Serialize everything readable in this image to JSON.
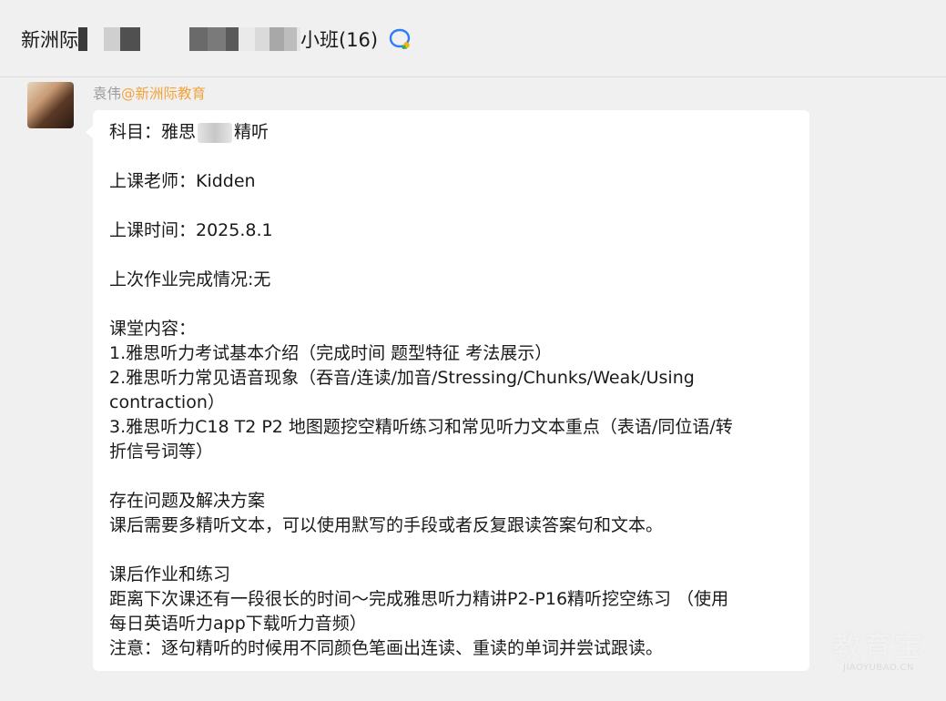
{
  "header": {
    "title_start": "新洲际",
    "title_end": "小班(16)",
    "mosaic_colors": [
      "#3a3a3a",
      "#f0f0f0",
      "#cfcfcf",
      "#505050",
      "#f0f0f0",
      "#f0f0f0",
      "#6a6a6a",
      "#7a7a7a",
      "#5a5a5a",
      "#eaeaea",
      "#dadada",
      "#a8a8a8",
      "#bdbdbd",
      "#e6e6e6"
    ]
  },
  "message": {
    "sender_name": "袁伟",
    "sender_org": "@新洲际教育",
    "subject_prefix": "科目：雅思",
    "subject_suffix": "精听",
    "teacher": "上课老师：Kidden",
    "time": "上课时间：2025.8.1",
    "homework_status": "上次作业完成情况:无",
    "content_title": "课堂内容：",
    "content_1": "1.雅思听力考试基本介绍（完成时间 题型特征 考法展示）",
    "content_2a": "2.雅思听力常见语音现象（吞音/连读/加音/Stressing/Chunks/Weak/Using",
    "content_2b": "contraction）",
    "content_3a": "3.雅思听力C18 T2 P2 地图题挖空精听练习和常见听力文本重点（表语/同位语/转",
    "content_3b": "折信号词等）",
    "problem_title": "存在问题及解决方案",
    "problem_text": "课后需要多精听文本，可以使用默写的手段或者反复跟读答案句和文本。",
    "homework_title": "课后作业和练习",
    "homework_1a": "距离下次课还有一段很长的时间～完成雅思听力精讲P2-P16精听挖空练习 （使用",
    "homework_1b": "每日英语听力app下载听力音频）",
    "note": "注意：逐句精听的时候用不同颜色笔画出连读、重读的单词并尝试跟读。"
  },
  "watermark": {
    "main": "教育宝",
    "sub": "JIAOYUBAO.CN"
  },
  "colors": {
    "background": "#f0f0f0",
    "bubble": "#ffffff",
    "org_accent": "#f2a33a",
    "icon_blue": "#2f7cf6"
  }
}
